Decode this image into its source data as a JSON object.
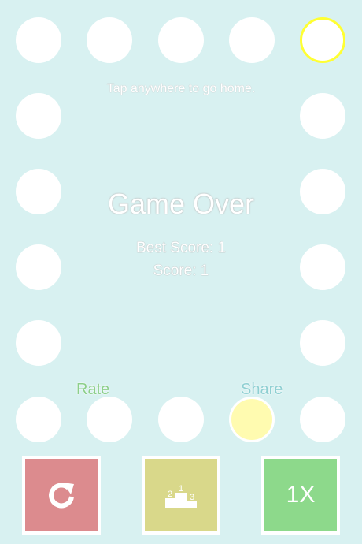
{
  "hint": "Tap anywhere to go home.",
  "title": "Game Over",
  "best_score_text": "Best Score: 1",
  "score_text": "Score: 1",
  "rate_label": "Rate",
  "share_label": "Share",
  "speed_label": "1X",
  "podium_labels": {
    "first": "1",
    "second": "2",
    "third": "3"
  },
  "icons": {
    "restart": "restart-icon",
    "leaderboard": "podium-icon"
  },
  "colors": {
    "background": "#d8f1f1",
    "restart": "#dc8b8e",
    "leaderboard": "#d9d88a",
    "speed": "#8dd98b",
    "rate_text": "#8ccf8a",
    "share_text": "#8ecfd2",
    "highlight_ring": "#ffff33",
    "active_dot": "#fffbb0"
  }
}
